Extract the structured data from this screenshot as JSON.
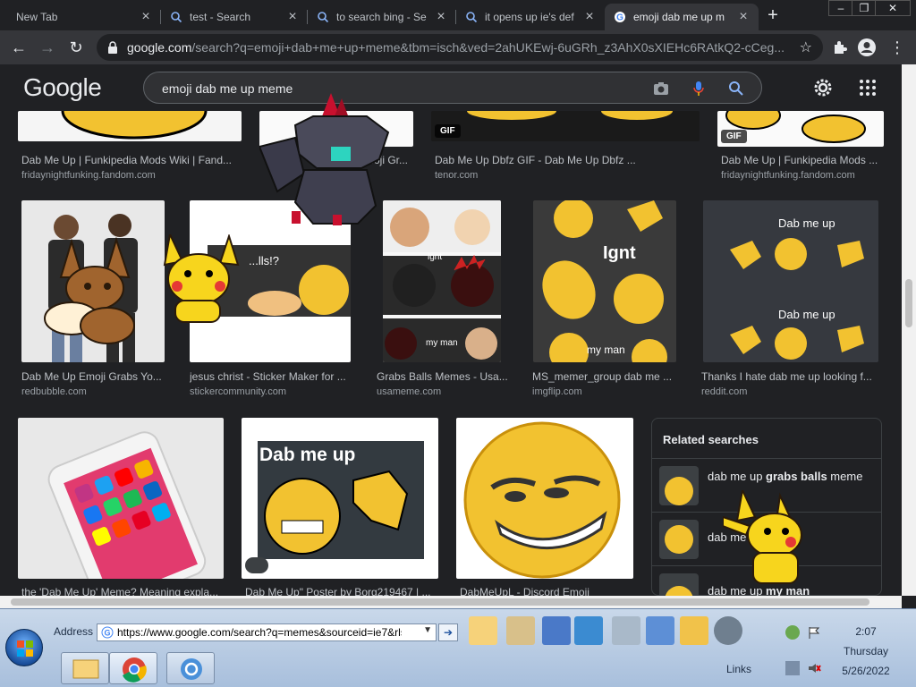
{
  "browser": {
    "tabs": [
      {
        "title": "New Tab",
        "active": false
      },
      {
        "title": "test - Search",
        "active": false
      },
      {
        "title": "to search bing - Se",
        "active": false
      },
      {
        "title": "it opens up ie's def",
        "active": false
      },
      {
        "title": "emoji dab me up m",
        "active": true
      }
    ],
    "new_tab_label": "+",
    "window_controls": {
      "minimize": "–",
      "restore": "❐",
      "close": "✕"
    },
    "url_host": "google.com",
    "url_rest": "/search?q=emoji+dab+me+up+meme&tbm=isch&ved=2ahUKEwj-6uGRh_z3AhX0sXIEHc6RAtkQ2-cCeg...",
    "star_label": "☆"
  },
  "google": {
    "logo": "Google",
    "query": "emoji dab me up meme"
  },
  "results": {
    "row1": [
      {
        "title": "Dab Me Up | Funkipedia Mods Wiki | Fand...",
        "site": "fridaynightfunking.fandom.com"
      },
      {
        "title": "...oji Gr...",
        "site": ""
      },
      {
        "title": "Dab Me Up Dbfz GIF - Dab Me Up Dbfz ...",
        "site": "tenor.com",
        "badge": "GIF"
      },
      {
        "title": "Dab Me Up | Funkipedia Mods ...",
        "site": "fridaynightfunking.fandom.com",
        "badge": "GIF"
      }
    ],
    "row2": [
      {
        "title": "Dab Me Up Emoji Grabs Yo...",
        "site": "redbubble.com"
      },
      {
        "title": "jesus christ - Sticker Maker for ...",
        "site": "stickercommunity.com",
        "overlay": "...lls!?"
      },
      {
        "title": "Grabs Balls Memes - Usa...",
        "site": "usameme.com",
        "labels": [
          "ignt",
          "my man"
        ]
      },
      {
        "title": "MS_memer_group dab me ...",
        "site": "imgflip.com",
        "labels": [
          "Ignt",
          "my man"
        ]
      },
      {
        "title": "Thanks I hate dab me up looking f...",
        "site": "reddit.com",
        "labels": [
          "Dab me up",
          "Dab me up"
        ]
      }
    ],
    "row3": [
      {
        "title": "the 'Dab Me Up' Meme? Meaning expla...",
        "site": ""
      },
      {
        "title": "Dab Me Up\" Poster by Borg219467 | ...",
        "site": "",
        "overlay": "Dab me up"
      },
      {
        "title": "DabMeUpL - Discord Emoji",
        "site": ""
      }
    ]
  },
  "related": {
    "heading": "Related searches",
    "items": [
      {
        "plain": "dab me up ",
        "bold": "grabs balls",
        "tail": " meme"
      },
      {
        "plain": "dab me up",
        "bold": "",
        "tail": ""
      },
      {
        "plain": "dab me up ",
        "bold": "my man",
        "tail": ""
      }
    ]
  },
  "taskbar": {
    "address_label": "Address",
    "address_value": "https://www.google.com/search?q=memes&sourceid=ie7&rls=",
    "go_label": "➔",
    "links_label": "Links",
    "clock_time": "2:07",
    "clock_day": "Thursday",
    "clock_date": "5/26/2022"
  },
  "colors": {
    "page_bg": "#202124",
    "emoji_yellow": "#f2c230",
    "pikachu_yellow": "#f7d51d"
  }
}
